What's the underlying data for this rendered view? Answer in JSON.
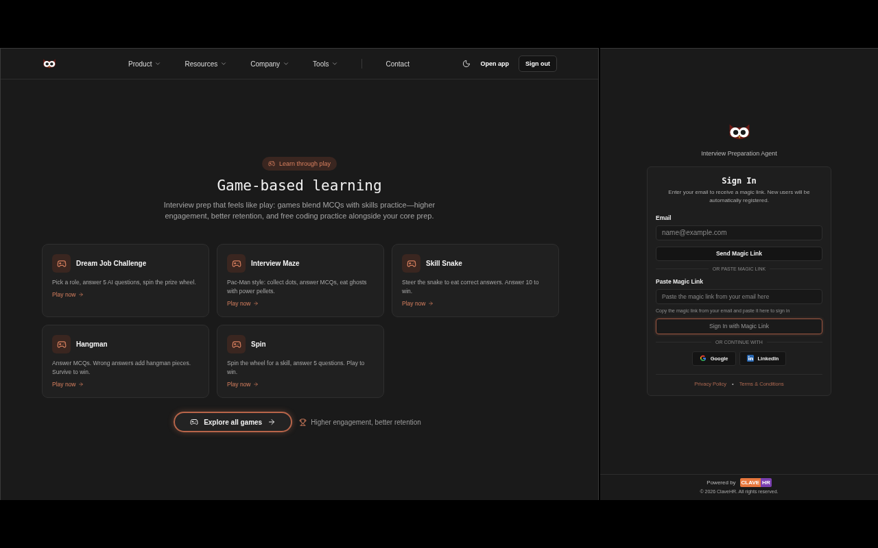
{
  "nav": {
    "links": [
      {
        "label": "Product",
        "dropdown": true
      },
      {
        "label": "Resources",
        "dropdown": true
      },
      {
        "label": "Company",
        "dropdown": true
      },
      {
        "label": "Tools",
        "dropdown": true
      },
      {
        "label": "Contact",
        "dropdown": false
      }
    ],
    "open_app": "Open app",
    "sign_out": "Sign out"
  },
  "hero": {
    "badge": "Learn through play",
    "title": "Game-based learning",
    "subtitle": "Interview prep that feels like play: games blend MCQs with skills practice—higher engagement, better retention, and free coding practice alongside your core prep."
  },
  "games": [
    {
      "title": "Dream Job Challenge",
      "description": "Pick a role, answer 5 AI questions, spin the prize wheel.",
      "link": "Play now"
    },
    {
      "title": "Interview Maze",
      "description": "Pac-Man style: collect dots, answer MCQs, eat ghosts with power pellets.",
      "link": "Play now"
    },
    {
      "title": "Skill Snake",
      "description": "Steer the snake to eat correct answers. Answer 10 to win.",
      "link": "Play now"
    },
    {
      "title": "Hangman",
      "description": "Answer MCQs. Wrong answers add hangman pieces. Survive to win.",
      "link": "Play now"
    },
    {
      "title": "Spin",
      "description": "Spin the wheel for a skill, answer 5 questions. Play to win.",
      "link": "Play now"
    }
  ],
  "explore_button": "Explore all games",
  "tagline": "Higher engagement, better retention",
  "signin": {
    "app_name": "Interview Preparation Agent",
    "title": "Sign In",
    "intro": "Enter your email to receive a magic link. New users will be automatically registered.",
    "email_label": "Email",
    "email_placeholder": "name@example.com",
    "send_button": "Send Magic Link",
    "divider_1": "OR PASTE MAGIC LINK",
    "paste_label": "Paste Magic Link",
    "paste_placeholder": "Paste the magic link from your email here",
    "paste_hint": "Copy the magic link from your email and paste it here to sign in",
    "signin_button": "Sign In with Magic Link",
    "divider_2": "OR CONTINUE WITH",
    "providers": [
      {
        "kind": "google",
        "label": "Google"
      },
      {
        "kind": "linkedin",
        "label": "LinkedIn"
      }
    ],
    "footer_links": [
      "Privacy Policy",
      "Terms & Conditions"
    ],
    "footer_separator": "•"
  },
  "powered": {
    "label": "Powered by",
    "logo_left": "CLAVE",
    "logo_right": "HR",
    "copyright": "© 2026 ClaveHR. All rights reserved."
  }
}
